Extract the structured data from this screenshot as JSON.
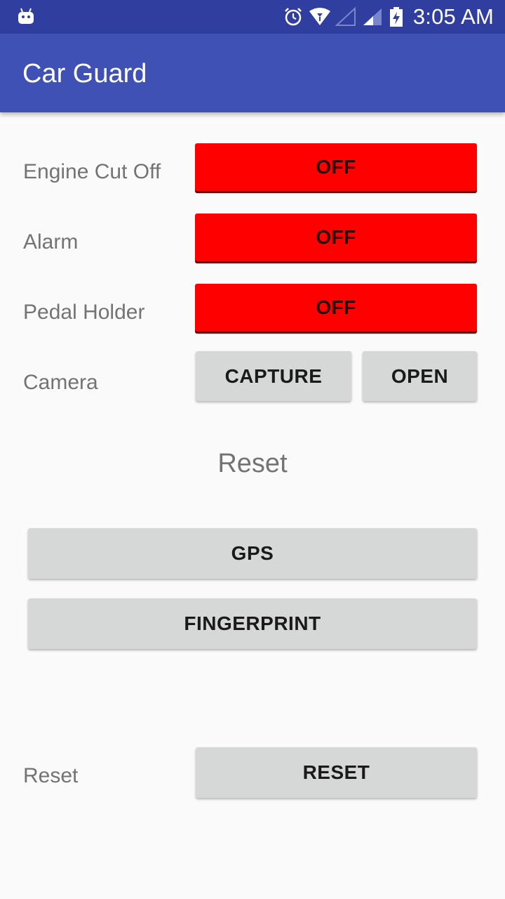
{
  "status_bar": {
    "time": "3:05 AM",
    "icons": [
      "android-debug-icon",
      "alarm-icon",
      "wifi-icon",
      "cellular-signal-1-icon",
      "cellular-signal-2-icon",
      "battery-charging-icon"
    ]
  },
  "app_bar": {
    "title": "Car Guard"
  },
  "controls": {
    "engine": {
      "label": "Engine Cut Off",
      "button": "OFF"
    },
    "alarm": {
      "label": "Alarm",
      "button": "OFF"
    },
    "pedal": {
      "label": "Pedal Holder",
      "button": "OFF"
    },
    "camera": {
      "label": "Camera",
      "capture": "CAPTURE",
      "open": "OPEN"
    }
  },
  "reset_section": {
    "heading": "Reset",
    "gps": "GPS",
    "fingerprint": "FINGERPRINT"
  },
  "bottom_reset": {
    "label": "Reset",
    "button": "RESET"
  },
  "colors": {
    "status_bar": "#303f9f",
    "app_bar": "#3f51b5",
    "off_button": "#ff0000",
    "gray_button": "#d6d7d7",
    "background": "#fafafa"
  }
}
